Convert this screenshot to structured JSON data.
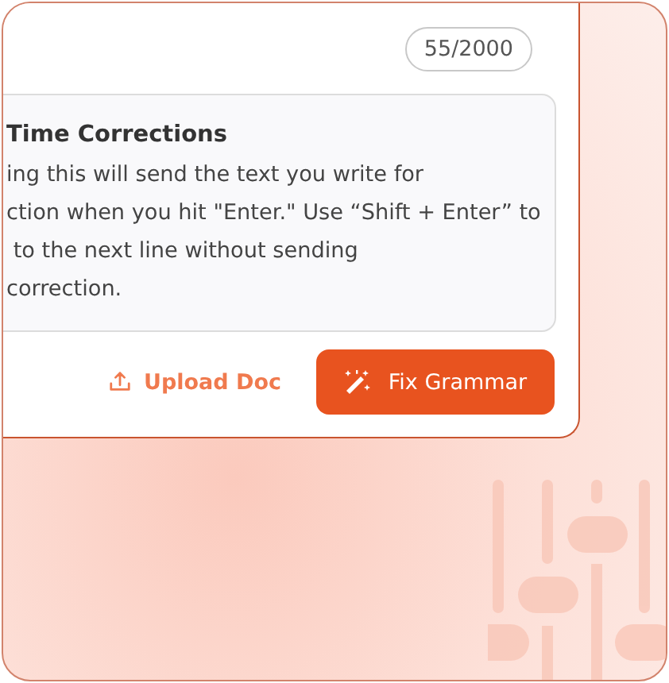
{
  "counter": "55/2000",
  "info": {
    "title": "Time Corrections",
    "lines": [
      "ing this will send the text you write for",
      "ction when you hit \"Enter.\" Use “Shift + Enter” to",
      " to the next line without sending",
      "correction."
    ]
  },
  "buttons": [
    {
      "kind": "upload",
      "label": "Upload Doc"
    },
    {
      "kind": "primary",
      "label": "Fix Grammar"
    }
  ]
}
